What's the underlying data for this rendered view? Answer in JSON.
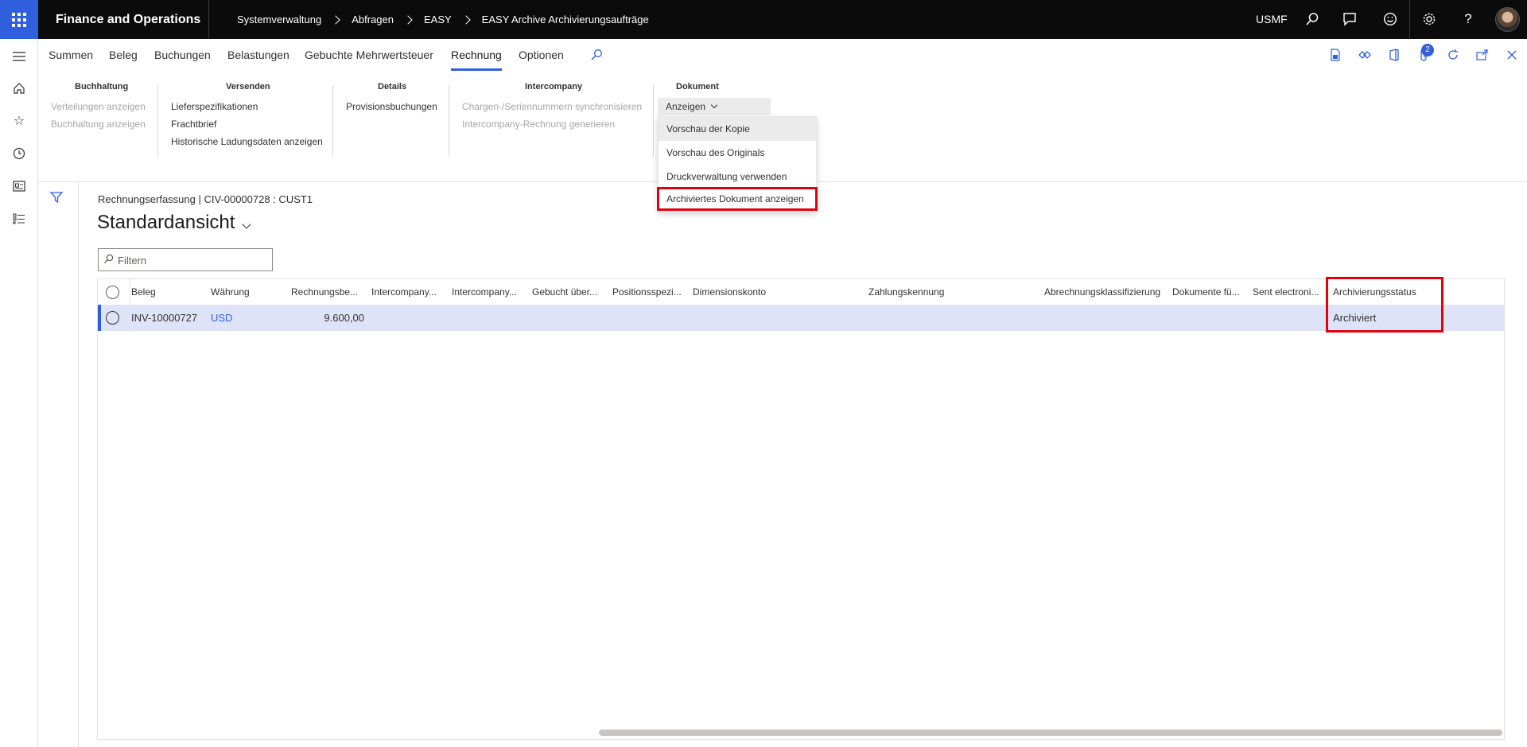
{
  "app": {
    "title": "Finance and Operations",
    "company": "USMF",
    "breadcrumb": [
      "Systemverwaltung",
      "Abfragen",
      "EASY",
      "EASY Archive Archivierungsaufträge"
    ],
    "notification_count": "2"
  },
  "tabs": [
    {
      "label": "Summen"
    },
    {
      "label": "Beleg"
    },
    {
      "label": "Buchungen"
    },
    {
      "label": "Belastungen"
    },
    {
      "label": "Gebuchte Mehrwertsteuer"
    },
    {
      "label": "Rechnung",
      "active": true
    },
    {
      "label": "Optionen"
    }
  ],
  "ribbon": {
    "groups": [
      {
        "title": "Buchhaltung",
        "items": [
          "Verteilungen anzeigen",
          "Buchhaltung anzeigen"
        ]
      },
      {
        "title": "Versenden",
        "items": [
          "Lieferspezifikationen",
          "Frachtbrief",
          "Historische Ladungsdaten anzeigen"
        ]
      },
      {
        "title": "Details",
        "items": [
          "Provisionsbuchungen"
        ]
      },
      {
        "title": "Intercompany",
        "items": [
          "Chargen-/Seriennummern synchronisieren",
          "Intercompany-Rechnung generieren"
        ]
      },
      {
        "title": "Dokument",
        "button": "Anzeigen"
      }
    ],
    "dropdown": [
      "Vorschau der Kopie",
      "Vorschau des Originals",
      "Druckverwaltung verwenden",
      "Archiviertes Dokument anzeigen"
    ]
  },
  "content": {
    "caption": "Rechnungserfassung  |  CIV-00000728 : CUST1",
    "view_title": "Standardansicht",
    "filter_placeholder": "Filtern"
  },
  "grid": {
    "columns": [
      "Beleg",
      "Währung",
      "Rechnungsbe...",
      "Intercompany...",
      "Intercompany...",
      "Gebucht über...",
      "Positionsspezi...",
      "Dimensionskonto",
      "Zahlungskennung",
      "Abrechnungsklassifizierung",
      "Dokumente fü...",
      "Sent electroni...",
      "Archivierungsstatus"
    ],
    "rows": [
      {
        "beleg": "INV-10000727",
        "waehrung": "USD",
        "betrag": "9.600,00",
        "status": "Archiviert"
      }
    ]
  },
  "colors": {
    "accent": "#2f5fdd",
    "topbar": "#0b0b0b",
    "highlight": "#e0000e",
    "selected_row": "#dfe3f8"
  }
}
